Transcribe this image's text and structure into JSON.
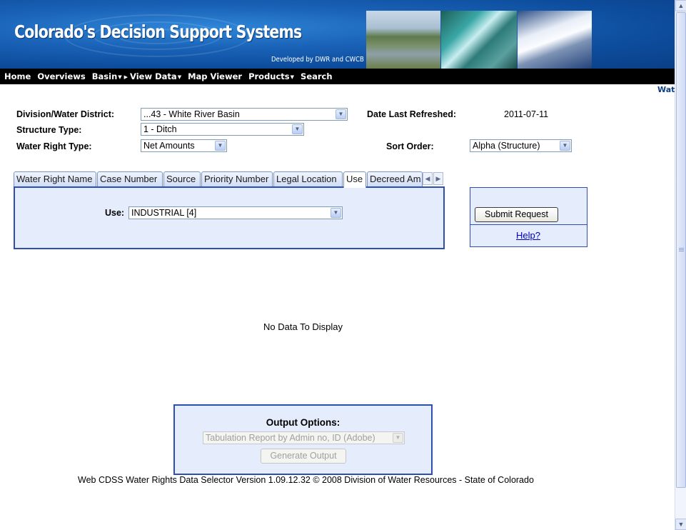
{
  "banner": {
    "title": "Colorado's Decision Support Systems",
    "subtitle": "Developed by DWR and CWCB"
  },
  "nav": {
    "items": [
      {
        "label": "Home"
      },
      {
        "label": "Overviews"
      },
      {
        "label": "Basin",
        "dropdown": true
      },
      {
        "label": "View Data",
        "dropdown": true
      },
      {
        "label": "Map Viewer"
      },
      {
        "label": "Products",
        "dropdown": true
      },
      {
        "label": "Search"
      }
    ],
    "edge_text": "Wat"
  },
  "form": {
    "division_label": "Division/Water District:",
    "division_value": "...43 - White River Basin",
    "structure_type_label": "Structure Type:",
    "structure_type_value": "1 - Ditch",
    "water_right_type_label": "Water Right Type:",
    "water_right_type_value": "Net Amounts",
    "date_refreshed_label": "Date Last Refreshed:",
    "date_refreshed_value": "2011-07-11",
    "sort_order_label": "Sort Order:",
    "sort_order_value": "Alpha (Structure)"
  },
  "tabs": {
    "items": [
      "Water Right Name",
      "Case Number",
      "Source",
      "Priority Number",
      "Legal Location",
      "Use",
      "Decreed Am"
    ],
    "active": "Use"
  },
  "use_panel": {
    "label": "Use:",
    "value": "INDUSTRIAL [4]"
  },
  "actions": {
    "submit_label": "Submit Request",
    "help_label": "Help?"
  },
  "results": {
    "empty_message": "No Data To Display"
  },
  "output": {
    "title": "Output Options:",
    "report_value": "Tabulation Report by Admin no, ID (Adobe)",
    "generate_label": "Generate Output"
  },
  "footer": {
    "text": "Web CDSS Water Rights Data Selector Version 1.09.12.32 © 2008 Division of Water Resources - State of Colorado"
  },
  "colors": {
    "banner_blue": "#0d4c9c",
    "panel_border": "#2d4fb0",
    "panel_fill": "#e5ecfb",
    "link": "#0000c0"
  }
}
